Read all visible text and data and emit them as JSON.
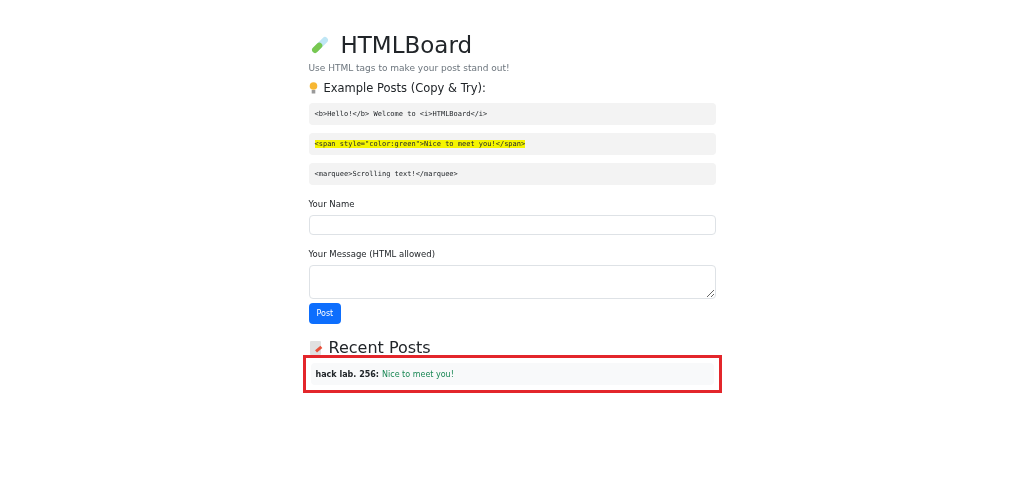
{
  "header": {
    "title": "HTMLBoard",
    "subtitle": "Use HTML tags to make your post stand out!"
  },
  "examples": {
    "heading": "Example Posts (Copy & Try):",
    "items": [
      {
        "code": "<b>Hello!</b> Welcome to <i>HTMLBoard</i>",
        "highlighted": false
      },
      {
        "code": "<span style=\"color:green\">Nice to meet you!</span>",
        "highlighted": true
      },
      {
        "code": "<marquee>Scrolling text!</marquee>",
        "highlighted": false
      }
    ]
  },
  "form": {
    "name_label": "Your Name",
    "message_label": "Your Message (HTML allowed)",
    "button": "Post"
  },
  "recent": {
    "heading": "Recent Posts",
    "posts": [
      {
        "author": "hack lab. 256:",
        "message": "Nice to meet you!",
        "annotated": true
      }
    ]
  }
}
